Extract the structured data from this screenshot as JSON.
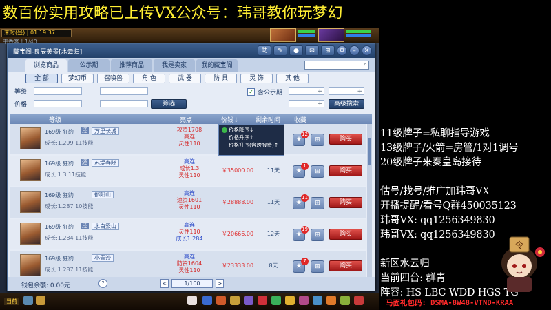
{
  "banner": "数百份实用攻略已上传VX公众号：玮哥教你玩梦幻",
  "status": {
    "time": "末时(昼) | 01:19:37",
    "sub": "书香客 | 1/40"
  },
  "window": {
    "title": "藏宝阁-良辰美景[水云归]",
    "tabs": [
      "浏览商品",
      "公示期",
      "推荐商品",
      "我是卖家",
      "我的藏宝阁"
    ],
    "categories": [
      "全 部",
      "梦幻币",
      "召唤兽",
      "角 色",
      "武 器",
      "防 具",
      "灵 饰",
      "其 他"
    ],
    "filters": {
      "level_label": "等级",
      "price_label": "价格",
      "filter_button": "筛选",
      "public_label": "含公示期",
      "advanced_button": "高级搜索"
    },
    "columns": {
      "level": "等级",
      "features": "亮点",
      "price": "价钱↓",
      "time_left": "剩余时间",
      "fav": "收藏"
    },
    "sort_popup": [
      "价格降序↓",
      "价格升序↑",
      "价格升序(含跨服费)↑"
    ],
    "rows": [
      {
        "level": "169级",
        "race": "狂豹",
        "tag": "还",
        "name": "万里长城",
        "growth": "成长:1.299",
        "skills": "11技能",
        "features": [
          "攻资1708",
          "高连",
          "灵性110"
        ],
        "price": "",
        "time": "",
        "fav_count": "12",
        "buy": "购买"
      },
      {
        "level": "169级",
        "race": "狂豹",
        "tag": "还",
        "name": "苏堤春晓",
        "growth": "成长:1.3",
        "skills": "11技能",
        "features": [
          "高连",
          "成长1.3",
          "灵性110"
        ],
        "price": "￥35000.00",
        "time": "11天",
        "fav_count": "1",
        "buy": "购买"
      },
      {
        "level": "169级",
        "race": "狂豹",
        "tag": "",
        "name": "鄱阳山",
        "growth": "成长:1.287",
        "skills": "10技能",
        "features": [
          "高连",
          "速资1601",
          "灵性110"
        ],
        "price": "￥28888.00",
        "time": "11天",
        "fav_count": "11",
        "buy": "购买"
      },
      {
        "level": "169级",
        "race": "狂豹",
        "tag": "还",
        "name": "水白梁山",
        "growth": "成长:1.284",
        "skills": "11技能",
        "features": [
          "高连",
          "灵性110",
          "成长1.284"
        ],
        "price": "￥20666.00",
        "time": "12天",
        "fav_count": "19",
        "buy": "购买"
      },
      {
        "level": "169级",
        "race": "狂豹",
        "tag": "",
        "name": "小青沙",
        "growth": "成长:1.287",
        "skills": "11技能",
        "features": [
          "高连",
          "防资1604",
          "灵性110"
        ],
        "price": "￥23333.00",
        "time": "8天",
        "fav_count": "7",
        "buy": "购买"
      }
    ],
    "footer": {
      "balance": "钱包余额: 0.00元",
      "help": "?",
      "prev": "<",
      "page": "1/100",
      "next": ">"
    }
  },
  "bottombar": {
    "label": "当前"
  },
  "right_panel": {
    "lines": [
      "11级牌子=私聊指导游戏",
      "13级牌子/火箭=房管/1对1调号",
      "20级牌子来秦皇岛接待",
      "",
      "估号/找号/推广加玮哥VX",
      "开播提醒/看号Q群450035123",
      "玮哥VX: qq1256349830",
      "玮哥VX: qq1256349830",
      "",
      "新区水云归",
      "当前四台: 群青",
      "阵容: HS LBC WDD HGS TG"
    ],
    "gift_code": "马面礼包码: DSMA-8W48-VTND-KRAA"
  },
  "colors": {
    "banner": "#ffee33",
    "buy": "#c02020",
    "window_title": "#2e4f7e"
  }
}
